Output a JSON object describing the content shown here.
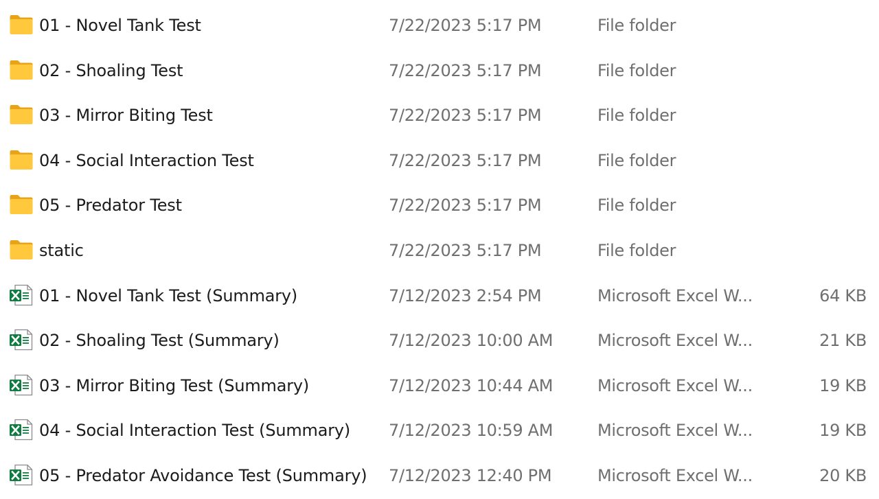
{
  "files": [
    {
      "name": "01 - Novel Tank Test",
      "date_modified": "7/22/2023 5:17 PM",
      "type": "File folder",
      "size": "",
      "icon": "folder-icon"
    },
    {
      "name": "02 - Shoaling Test",
      "date_modified": "7/22/2023 5:17 PM",
      "type": "File folder",
      "size": "",
      "icon": "folder-icon"
    },
    {
      "name": "03 - Mirror Biting Test",
      "date_modified": "7/22/2023 5:17 PM",
      "type": "File folder",
      "size": "",
      "icon": "folder-icon"
    },
    {
      "name": "04 - Social Interaction Test",
      "date_modified": "7/22/2023 5:17 PM",
      "type": "File folder",
      "size": "",
      "icon": "folder-icon"
    },
    {
      "name": "05 - Predator Test",
      "date_modified": "7/22/2023 5:17 PM",
      "type": "File folder",
      "size": "",
      "icon": "folder-icon"
    },
    {
      "name": "static",
      "date_modified": "7/22/2023 5:17 PM",
      "type": "File folder",
      "size": "",
      "icon": "folder-icon"
    },
    {
      "name": "01 - Novel Tank Test (Summary)",
      "date_modified": "7/12/2023 2:54 PM",
      "type": "Microsoft Excel W...",
      "size": "64 KB",
      "icon": "excel-file-icon"
    },
    {
      "name": "02 - Shoaling Test (Summary)",
      "date_modified": "7/12/2023 10:00 AM",
      "type": "Microsoft Excel W...",
      "size": "21 KB",
      "icon": "excel-file-icon"
    },
    {
      "name": "03 - Mirror Biting Test (Summary)",
      "date_modified": "7/12/2023 10:44 AM",
      "type": "Microsoft Excel W...",
      "size": "19 KB",
      "icon": "excel-file-icon"
    },
    {
      "name": "04 - Social Interaction Test (Summary)",
      "date_modified": "7/12/2023 10:59 AM",
      "type": "Microsoft Excel W...",
      "size": "19 KB",
      "icon": "excel-file-icon"
    },
    {
      "name": "05 - Predator Avoidance Test (Summary)",
      "date_modified": "7/12/2023 12:40 PM",
      "type": "Microsoft Excel W...",
      "size": "20 KB",
      "icon": "excel-file-icon"
    }
  ],
  "colors": {
    "folder_body": "#ffc83d",
    "folder_back": "#e8a317",
    "excel_green": "#107c41",
    "text_primary": "#1b1b1b",
    "text_secondary": "#6f6f6f"
  }
}
